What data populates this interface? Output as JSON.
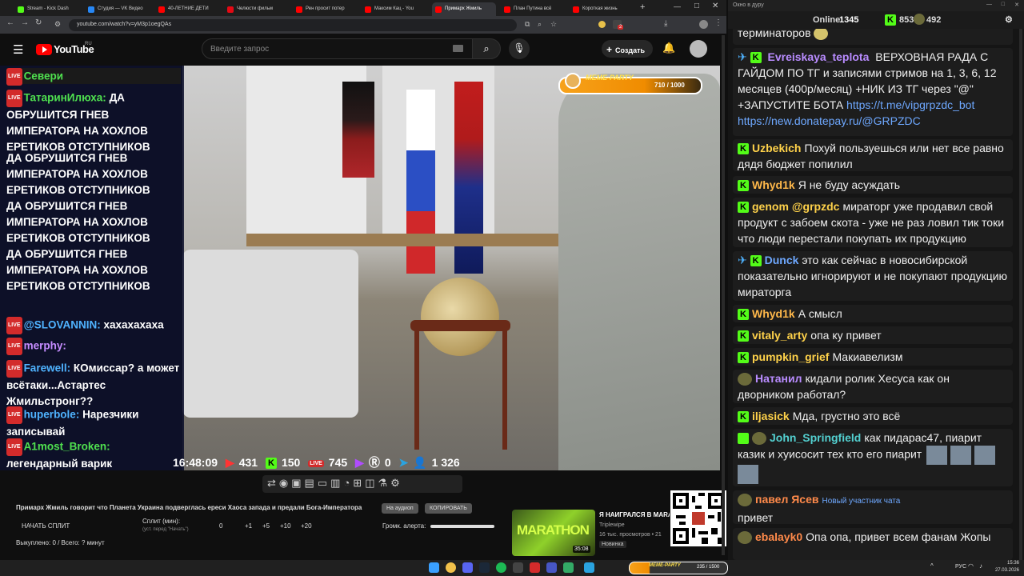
{
  "browser": {
    "tabs": [
      {
        "title": "Stream - Kick Dash",
        "color": "#53fc18",
        "active": false
      },
      {
        "title": "Студия — VK Видео",
        "color": "#2787f5",
        "active": false
      },
      {
        "title": "40-ЛЕТНИЕ ДЕТИ",
        "color": "#ff0000",
        "active": false
      },
      {
        "title": "Челюсти фильм",
        "color": "#e50914",
        "active": false
      },
      {
        "title": "Рен просит потер",
        "color": "#ff0000",
        "active": false
      },
      {
        "title": "Максим Кац - You",
        "color": "#ff0000",
        "active": false
      },
      {
        "title": "Примарх Жмиль",
        "color": "#ff0000",
        "active": true
      },
      {
        "title": "План Путина всё",
        "color": "#ff0000",
        "active": false
      },
      {
        "title": "Короткая жизнь",
        "color": "#ff0000",
        "active": false
      }
    ],
    "url": "youtube.com/watch?v=yM3p1oegQAs",
    "ext_badge": "2"
  },
  "youtube": {
    "logo_text": "YouTube",
    "logo_region": "RU",
    "search_placeholder": "Введите запрос",
    "create_label": "Создать"
  },
  "overlay_chat": [
    {
      "user": "Севери",
      "text": "",
      "color": "#4fe04f"
    },
    {
      "user": "ТатаринИлюха:",
      "text": "ДА ОБРУШИТСЯ ГНЕВ ИМПЕРАТОРА НА ХОХЛОВ ЕРЕТИКОВ ОТСТУПНИКОВ",
      "color": "#4fe04f"
    },
    {
      "user": "",
      "text": "ДА ОБРУШИТСЯ ГНЕВ ИМПЕРАТОРА НА ХОХЛОВ ЕРЕТИКОВ ОТСТУПНИКОВ",
      "color": "#fff"
    },
    {
      "user": "",
      "text": "ДА ОБРУШИТСЯ ГНЕВ ИМПЕРАТОРА НА ХОХЛОВ ЕРЕТИКОВ ОТСТУПНИКОВ",
      "color": "#fff"
    },
    {
      "user": "",
      "text": "ДА ОБРУШИТСЯ ГНЕВ ИМПЕРАТОРА НА ХОХЛОВ ЕРЕТИКОВ ОТСТУПНИКОВ",
      "color": "#fff"
    },
    {
      "user": "@SLOVANNIN:",
      "text": "хахахахаха",
      "color": "#4fb3ff"
    },
    {
      "user": "merphy:",
      "text": "",
      "color": "#c58cff"
    },
    {
      "user": "Farewell:",
      "text": "КОмиссар? а может всётаки...Астартес Жмильстронг??",
      "color": "#4fb3ff"
    },
    {
      "user": "huperbole:",
      "text": "Нарезчики записывай",
      "color": "#4fb3ff"
    },
    {
      "user": "A1most_Broken:",
      "text": "легендарный варик",
      "color": "#4fe04f"
    }
  ],
  "stream_status": {
    "time": "16:48:09",
    "youtube_viewers": "431",
    "kick_viewers": "150",
    "vk_viewers": "745",
    "twitch_viewers": "0",
    "rutube_viewers": "",
    "total_viewers": "1 326"
  },
  "meme_party": {
    "label": "MEME-PARTY",
    "progress_text": "710 / 1000",
    "progress": 0.71
  },
  "under_video": {
    "title": "Примарх Жмиль говорит что Планета Украина подверглась ереси Хаоса запада и предали Бога-Императора",
    "btn_audio": "На аудиоп",
    "btn_copy": "КОПИРОВАТЬ",
    "start_split": "НАЧАТЬ СПЛИТ",
    "split_min_label": "Сплит (мин):",
    "split_hint": "(уст. перед \"Начать\")",
    "split_value": "0",
    "increments": [
      "+1",
      "+5",
      "+10",
      "+20"
    ],
    "volume_label": "Громк. алерта:",
    "done_text": "Выкуплено: 0 / Всего: ? минут",
    "rec_title": "Я НАИГРАЛСЯ В MARA",
    "rec_channel": "Triplewipe",
    "rec_stats": "16 тыс. просмотров • 21",
    "rec_new": "Новинка",
    "rec_duration": "35:08",
    "rec_thumb_text": "MARATHON"
  },
  "chat_panel": {
    "window_title": "Окно в дуру",
    "online_label": "Online:",
    "online_value": "1345",
    "kick_count": "853",
    "other_count": "492",
    "messages": [
      {
        "user": "",
        "text": "терминаторов",
        "user_color": "#fff"
      },
      {
        "user": "Evreiskaya_teplota",
        "text": "ВЕРХОВНАЯ РАДА С ГАЙДОМ ПО ТГ и записями стримов на 1, 3, 6, 12 месяцев (400р/месяц) +НИК ИЗ ТГ через \"@\" +ЗАПУСТИТЕ БОТА",
        "link1": "https://t.me/vipgrpzdc_bot",
        "link2": "https://new.donatepay.ru/@GRPZDC",
        "user_color": "#b98cff"
      },
      {
        "user": "Uzbekich",
        "text": "Похуй пользуешься или нет все равно дядя бюджет попилил",
        "user_color": "#ffd24a"
      },
      {
        "user": "Whyd1k",
        "text": "Я не буду асуждать",
        "user_color": "#ffb84a"
      },
      {
        "user": "genom",
        "mention": "@grpzdc",
        "text": "мираторг уже продавил свой продукт с забоем скота - уже не раз ловил тик токи что люди перестали покупать их продукцию",
        "user_color": "#ffd24a"
      },
      {
        "user": "Dunck",
        "text": "это как сейчас в новосибирской показательно игнорируют и не покупают продукцию мираторга",
        "user_color": "#6ea8ff"
      },
      {
        "user": "Whyd1k",
        "text": "А смысл",
        "user_color": "#ffb84a"
      },
      {
        "user": "vitaly_arty",
        "text": "опа ку привет",
        "user_color": "#ffd24a"
      },
      {
        "user": "pumpkin_grief",
        "text": "Макиавелизм",
        "user_color": "#ffd24a"
      },
      {
        "user": "Натанил",
        "text": "кидали ролик Хесуса как он дворником работал?",
        "user_color": "#b98cff"
      },
      {
        "user": "iljasick",
        "text": "Мда, грустно это всё",
        "user_color": "#ffd24a"
      },
      {
        "user": "John_Springfield",
        "text": "как пидарас47, пиарит казик и хуисосит тех кто его пиарит",
        "user_color": "#53d0d0"
      },
      {
        "user": "павел Ясев",
        "badge": "Новый участник чата",
        "text": "привет",
        "user_color": "#ff8a4a"
      },
      {
        "user": "ebalayk0",
        "text": "Опа опа, привет всем фанам Жопы",
        "user_color": "#ff8a4a"
      }
    ]
  },
  "taskbar": {
    "lang": "РУС",
    "time": "15:36",
    "date": "27.03.2026",
    "meme_text": "MEME-PARTY",
    "meme_progress": "235 / 1500"
  }
}
